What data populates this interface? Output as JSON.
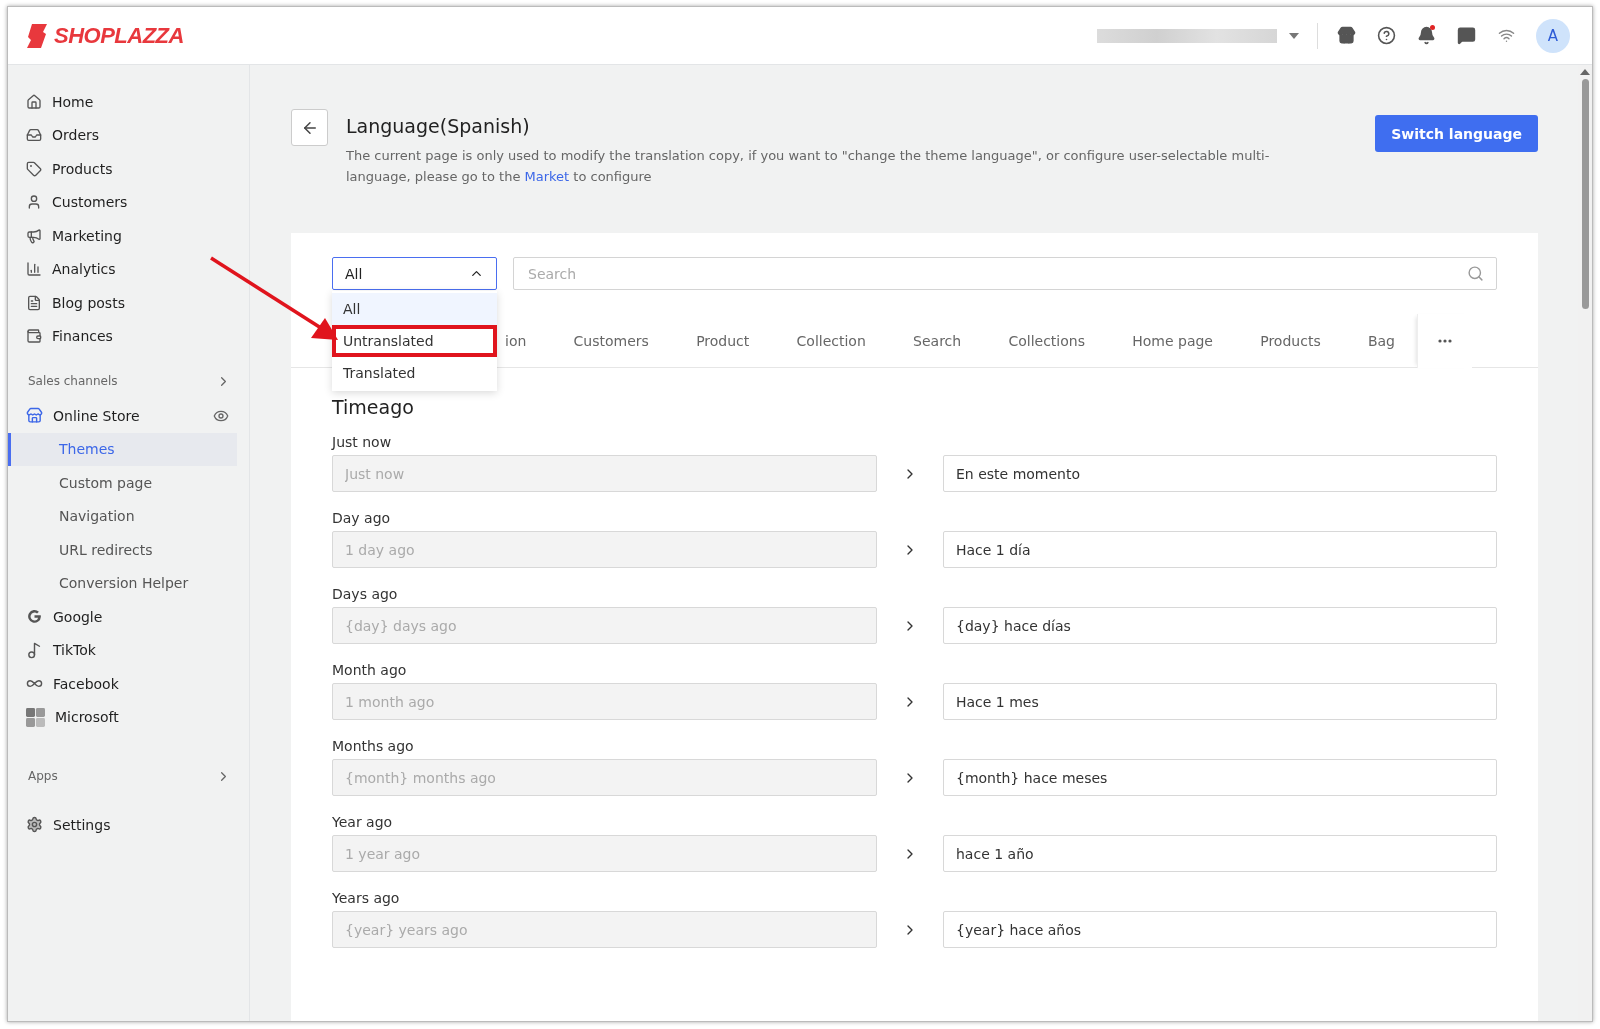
{
  "header": {
    "brand": "SHOPLAZZA",
    "avatar": "A",
    "notifications_unread": true
  },
  "sidebar": {
    "main_items": [
      {
        "label": "Home"
      },
      {
        "label": "Orders"
      },
      {
        "label": "Products"
      },
      {
        "label": "Customers"
      },
      {
        "label": "Marketing"
      },
      {
        "label": "Analytics"
      },
      {
        "label": "Blog posts"
      },
      {
        "label": "Finances"
      }
    ],
    "sales_channels": {
      "heading": "Sales channels",
      "items": [
        {
          "label": "Online Store",
          "expanded": true,
          "children": [
            {
              "label": "Themes",
              "selected": true
            },
            {
              "label": "Custom page",
              "selected": false
            },
            {
              "label": "Navigation",
              "selected": false
            },
            {
              "label": "URL redirects",
              "selected": false
            },
            {
              "label": "Conversion Helper",
              "selected": false
            }
          ]
        },
        {
          "label": "Google",
          "expanded": false
        },
        {
          "label": "TikTok",
          "expanded": false
        },
        {
          "label": "Facebook",
          "expanded": false
        },
        {
          "label": "Microsoft",
          "expanded": false
        }
      ]
    },
    "apps_heading": "Apps",
    "settings": "Settings"
  },
  "page": {
    "title": "Language(Spanish)",
    "description_before": "The current page is only used to modify the translation copy, if you want to \"change the theme language\", or configure user-selectable multi-language, please go to the ",
    "description_link": "Market",
    "description_after": " to configure",
    "primary_button": "Switch language"
  },
  "filter": {
    "value": "All",
    "expanded": true,
    "options": [
      {
        "label": "All",
        "selected": true,
        "highlighted": false
      },
      {
        "label": "Untranslated",
        "selected": false,
        "highlighted": true
      },
      {
        "label": "Translated",
        "selected": false,
        "highlighted": false
      }
    ]
  },
  "search": {
    "placeholder": "Search"
  },
  "tabs": [
    {
      "label": "ion",
      "selected": false
    },
    {
      "label": "Customers",
      "selected": false
    },
    {
      "label": "Product",
      "selected": false
    },
    {
      "label": "Collection",
      "selected": false
    },
    {
      "label": "Search",
      "selected": false
    },
    {
      "label": "Collections",
      "selected": false
    },
    {
      "label": "Home page",
      "selected": false
    },
    {
      "label": "Products",
      "selected": false
    },
    {
      "label": "Bag",
      "selected": false
    }
  ],
  "section": {
    "title": "Timeago",
    "rows": [
      {
        "label": "Just now",
        "source": "Just now",
        "translation": "En este momento"
      },
      {
        "label": "Day ago",
        "source": "1 day ago",
        "translation": "Hace 1 día"
      },
      {
        "label": "Days ago",
        "source": "{day} days ago",
        "translation": "{day} hace días"
      },
      {
        "label": "Month ago",
        "source": "1 month ago",
        "translation": "Hace 1 mes"
      },
      {
        "label": "Months ago",
        "source": "{month} months ago",
        "translation": "{month} hace meses"
      },
      {
        "label": "Year ago",
        "source": "1 year ago",
        "translation": "hace 1 año"
      },
      {
        "label": "Years ago",
        "source": "{year} years ago",
        "translation": "{year} hace años"
      }
    ]
  }
}
